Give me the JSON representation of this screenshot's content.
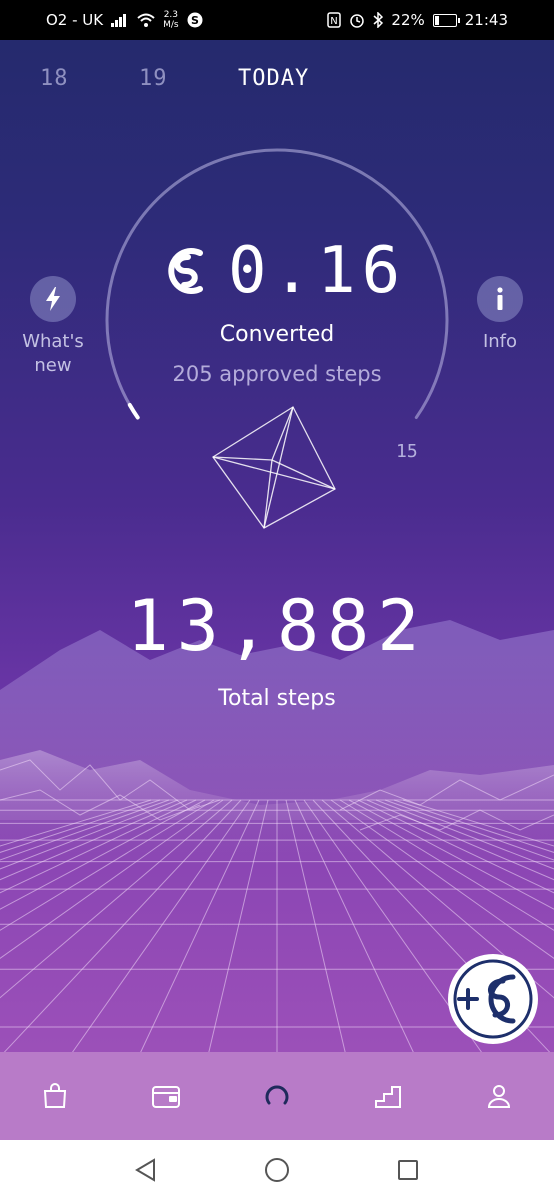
{
  "status_bar": {
    "carrier": "O2 - UK",
    "speed_value": "2.3",
    "speed_unit": "M/s",
    "battery": "22%",
    "battery_level": 0.22,
    "time": "21:43"
  },
  "days": {
    "prev2": "18",
    "prev1": "19",
    "today": "TODAY"
  },
  "side_left": {
    "label_line1": "What's",
    "label_line2": "new",
    "icon": "lightning-icon"
  },
  "side_right": {
    "label": "Info",
    "icon": "info-icon"
  },
  "balance": {
    "amount": "0.16",
    "converted_label": "Converted",
    "approved_steps": "205 approved steps",
    "gauge_max_label": "15",
    "gauge_progress": 0.16
  },
  "steps": {
    "total": "13,882",
    "label": "Total steps"
  },
  "bottom_nav": [
    {
      "name": "shop-icon"
    },
    {
      "name": "wallet-icon"
    },
    {
      "name": "home-loop-icon"
    },
    {
      "name": "stairs-icon"
    },
    {
      "name": "profile-icon"
    }
  ],
  "colors": {
    "bg_top": "#232a6b",
    "bg_bottom": "#a458bd",
    "bottom_nav": "#b87bc8",
    "coin_accent": "#1d2f6b"
  }
}
